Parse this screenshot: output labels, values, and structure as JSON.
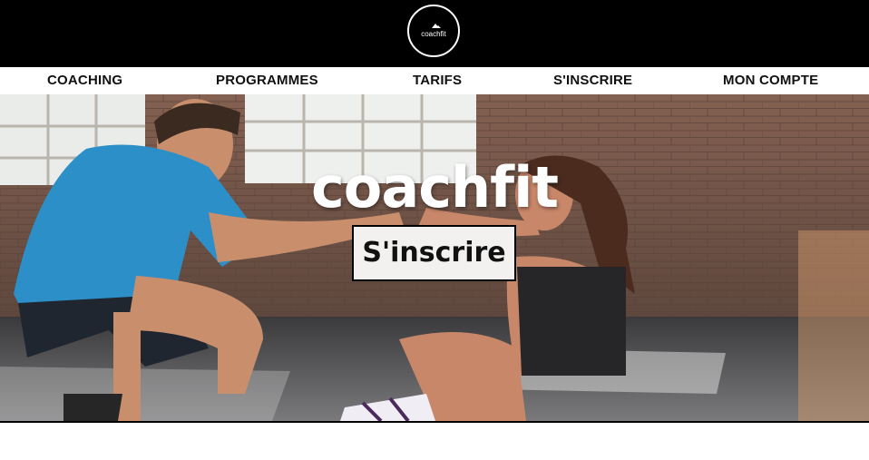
{
  "brand": {
    "logo_text": "coachfit"
  },
  "nav": {
    "items": [
      {
        "label": "COACHING"
      },
      {
        "label": "PROGRAMMES"
      },
      {
        "label": "TARIFS"
      },
      {
        "label": "S'INSCRIRE"
      },
      {
        "label": "MON COMPTE"
      }
    ]
  },
  "hero": {
    "title": "coachfit",
    "cta_label": "S'inscrire"
  }
}
